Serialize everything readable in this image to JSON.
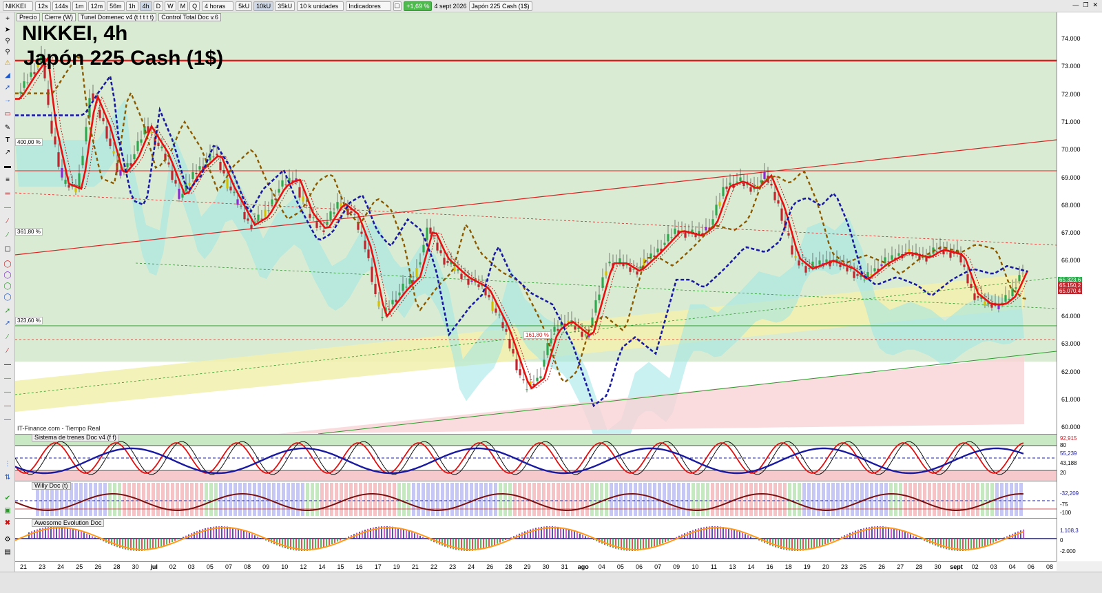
{
  "toolbar": {
    "symbol": "NIKKEI",
    "timeframes": [
      "12s",
      "144s",
      "1m",
      "12m",
      "56m",
      "1h",
      "4h",
      "D",
      "W",
      "M",
      "Q"
    ],
    "active_timeframe": "4h",
    "period": "4 horas",
    "tick_buttons": [
      "5kU",
      "10kU",
      "35kU"
    ],
    "active_tick": "10kU",
    "units": "10 k unidades",
    "indicators_label": "Indicadores",
    "change_badge": "+1,69 %",
    "date": "4 sept 2026",
    "instrument": "Japón 225 Cash (1$)"
  },
  "indicator_bar": [
    "Precio",
    "Cierre (W)",
    "Tunel Domenec v4 (t t t t t)",
    "Control Total Doc v.6"
  ],
  "chart": {
    "title": "NIKKEI, 4h",
    "subtitle": "Japón 225 Cash (1$)",
    "source": "IT-Finance.com - Tiempo Real",
    "fib_labels": [
      "400,00 %",
      "361,80 %",
      "323,60 %",
      "161,80 %"
    ],
    "y_ticks": [
      "74.000",
      "73.000",
      "72.000",
      "71.000",
      "70.000",
      "69.000",
      "68.000",
      "67.000",
      "66.000",
      "65.000",
      "64.000",
      "63.000",
      "62.000",
      "61.000",
      "60.000"
    ],
    "price_tags": [
      "65.323,6",
      "65.150,2",
      "65.070,4"
    ],
    "colors": {
      "up": "#2fa84f",
      "down": "#c0262d",
      "fast_ma": "#e81010",
      "slow_ma": "#8b5a00",
      "trend": "#1a1aa0",
      "bg": "#d7ebd0"
    }
  },
  "panels": [
    {
      "title": "Sistema de trenes Doc v4 (f f)",
      "ticks": [
        "92,915",
        "80",
        "55,239",
        "43,188",
        "20"
      ]
    },
    {
      "title": "Willy Doc (t)",
      "ticks": [
        "-32,209",
        "-75",
        "-100"
      ]
    },
    {
      "title": "Awesome Evolution Doc",
      "ticks": [
        "1.108,3",
        "0",
        "-2.000"
      ]
    }
  ],
  "x_labels": [
    "21",
    "23",
    "24",
    "25",
    "26",
    "28",
    "30",
    "jul",
    "02",
    "03",
    "05",
    "07",
    "08",
    "09",
    "10",
    "12",
    "14",
    "15",
    "16",
    "17",
    "19",
    "21",
    "22",
    "23",
    "24",
    "26",
    "28",
    "29",
    "30",
    "31",
    "ago",
    "04",
    "05",
    "06",
    "07",
    "09",
    "10",
    "11",
    "13",
    "14",
    "16",
    "18",
    "19",
    "20",
    "23",
    "25",
    "26",
    "27",
    "28",
    "30",
    "sept",
    "02",
    "03",
    "04",
    "06",
    "08"
  ]
}
